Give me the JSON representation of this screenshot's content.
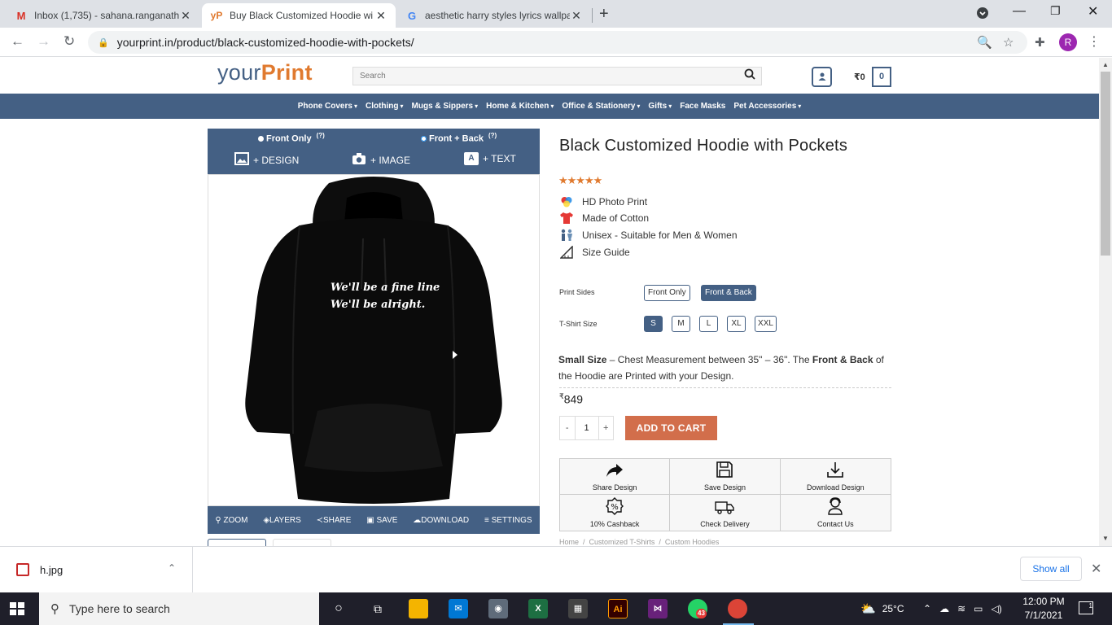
{
  "browser": {
    "tabs": [
      {
        "title": "Inbox (1,735) - sahana.ranganath",
        "favicon": "gmail-icon",
        "active": false
      },
      {
        "title": "Buy Black Customized Hoodie wi",
        "favicon": "yourprint-icon",
        "active": true
      },
      {
        "title": "aesthetic harry styles lyrics wallpa",
        "favicon": "google-icon",
        "active": false
      }
    ],
    "url": "yourprint.in/product/black-customized-hoodie-with-pockets/",
    "profile_initial": "R"
  },
  "site": {
    "logo_a": "your",
    "logo_b": "Print",
    "search_placeholder": "Search",
    "cart_total": "₹0",
    "cart_count": "0",
    "nav": [
      {
        "label": "Phone Covers",
        "dropdown": true
      },
      {
        "label": "Clothing",
        "dropdown": true
      },
      {
        "label": "Mugs & Sippers",
        "dropdown": true
      },
      {
        "label": "Home & Kitchen",
        "dropdown": true
      },
      {
        "label": "Office & Stationery",
        "dropdown": true
      },
      {
        "label": "Gifts",
        "dropdown": true
      },
      {
        "label": "Face Masks",
        "dropdown": false
      },
      {
        "label": "Pet Accessories",
        "dropdown": true
      }
    ]
  },
  "designer": {
    "side_front": "Front Only",
    "side_both": "Front + Back",
    "help": "(?)",
    "add_design": "+ DESIGN",
    "add_image": "+ IMAGE",
    "add_text": "+ TEXT",
    "hoodie_text_line1": "We'll be a fine line",
    "hoodie_text_line2": "We'll be alright.",
    "toolbar": [
      "ZOOM",
      "LAYERS",
      "SHARE",
      "SAVE",
      "DOWNLOAD",
      "SETTINGS"
    ]
  },
  "product": {
    "title": "Black Customized Hoodie with Pockets",
    "rating": "★★★★★",
    "features": [
      {
        "icon": "palette-icon",
        "text": "HD Photo Print"
      },
      {
        "icon": "tshirt-icon",
        "text": "Made of Cotton"
      },
      {
        "icon": "people-icon",
        "text": "Unisex - Suitable for Men & Women"
      },
      {
        "icon": "ruler-icon",
        "text": "Size Guide"
      }
    ],
    "print_sides_label": "Print Sides",
    "print_sides": [
      "Front Only",
      "Front & Back"
    ],
    "print_sides_selected": "Front & Back",
    "size_label": "T-Shirt Size",
    "sizes": [
      "S",
      "M",
      "L",
      "XL",
      "XXL"
    ],
    "size_selected": "S",
    "size_desc_bold": "Small Size",
    "size_desc_mid": " – Chest Measurement between 35\" – 36\". The ",
    "size_desc_bold2": "Front & Back",
    "size_desc_end": " of the Hoodie are Printed with your Design.",
    "currency": "₹",
    "price": "849",
    "qty_minus": "-",
    "qty_value": "1",
    "qty_plus": "+",
    "add_to_cart": "ADD TO CART",
    "actions": [
      {
        "icon": "share-arrow-icon",
        "label": "Share Design"
      },
      {
        "icon": "save-disk-icon",
        "label": "Save Design"
      },
      {
        "icon": "download-icon",
        "label": "Download Design"
      },
      {
        "icon": "cashback-icon",
        "label": "10% Cashback"
      },
      {
        "icon": "delivery-truck-icon",
        "label": "Check Delivery"
      },
      {
        "icon": "support-agent-icon",
        "label": "Contact Us"
      }
    ],
    "breadcrumb": [
      "Home",
      "Customized T-Shirts",
      "Custom Hoodies"
    ]
  },
  "downloads": {
    "file": "h.jpg",
    "show_all": "Show all"
  },
  "taskbar": {
    "search_placeholder": "Type here to search",
    "whatsapp_badge": "43",
    "temperature": "25°C",
    "time": "12:00 PM",
    "date": "7/1/2021",
    "notifications": "1"
  },
  "colors": {
    "brand_blue": "#446084",
    "brand_orange": "#e07a2f",
    "cart_button": "#d26e4b"
  }
}
